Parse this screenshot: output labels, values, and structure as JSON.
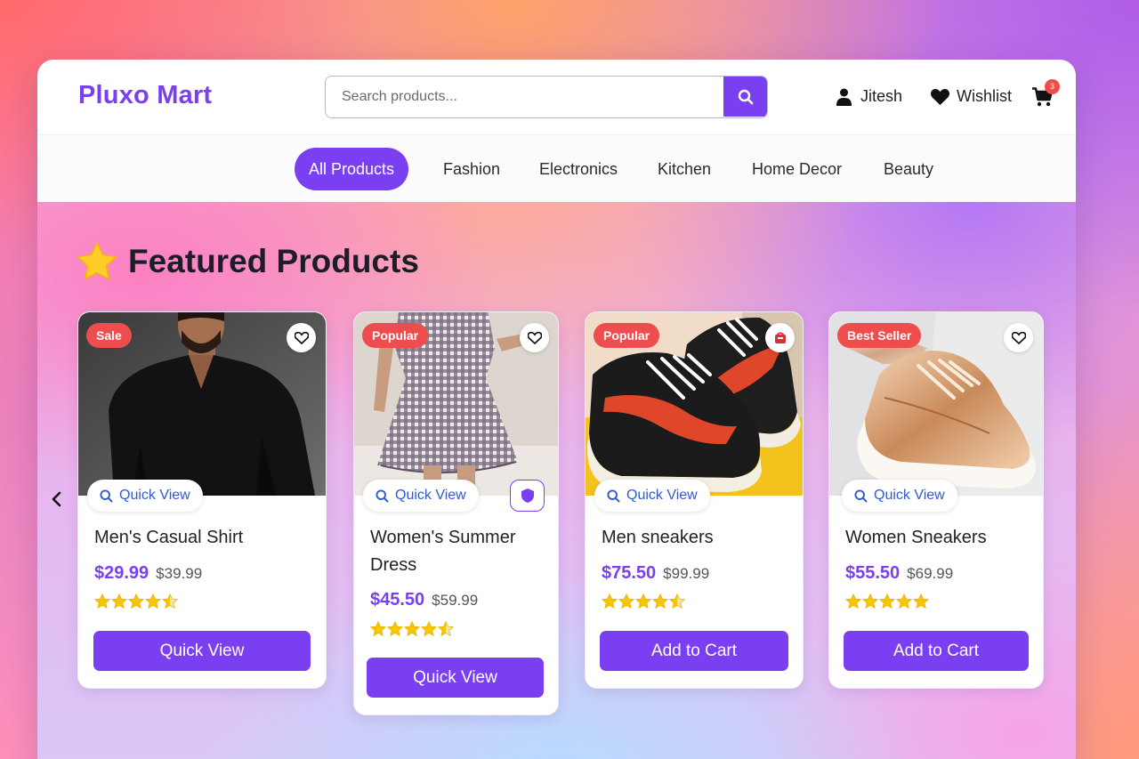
{
  "header": {
    "logo": "Pluxo Mart",
    "search_placeholder": "Search products...",
    "user_label": "Jitesh",
    "wishlist_label": "Wishlist",
    "cart_count": "3"
  },
  "nav": {
    "tabs": [
      {
        "label": "All Products",
        "active": true
      },
      {
        "label": "Fashion"
      },
      {
        "label": "Electronics"
      },
      {
        "label": "Kitchen"
      },
      {
        "label": "Home Decor"
      },
      {
        "label": "Beauty"
      }
    ]
  },
  "section": {
    "title": "Featured Products"
  },
  "products": [
    {
      "badge": "Sale",
      "name": "Men's Casual Shirt",
      "price": "$29.99",
      "old_price": "$39.99",
      "rating": 4.5,
      "quick_view": "Quick View",
      "button": "Quick View"
    },
    {
      "badge": "Popular",
      "name": "Women's Summer Dress",
      "price": "$45.50",
      "old_price": "$59.99",
      "rating": 4.5,
      "quick_view": "Quick View",
      "button": "Quick View"
    },
    {
      "badge": "Popular",
      "name": "Men sneakers",
      "price": "$75.50",
      "old_price": "$99.99",
      "rating": 4.5,
      "quick_view": "Quick View",
      "button": "Add to Cart"
    },
    {
      "badge": "Best Seller",
      "name": "Women Sneakers",
      "price": "$55.50",
      "old_price": "$69.99",
      "rating": 5,
      "quick_view": "Quick View",
      "button": "Add to Cart"
    }
  ],
  "colors": {
    "accent": "#7b3ff2",
    "badge": "#ee4d4d",
    "star": "#f7c600",
    "link": "#2f5bd3"
  },
  "icons": {
    "search": "search-icon",
    "user": "user-icon",
    "wishlist": "heart-icon",
    "cart": "cart-icon",
    "star": "star-icon",
    "prev": "chevron-left-icon"
  }
}
